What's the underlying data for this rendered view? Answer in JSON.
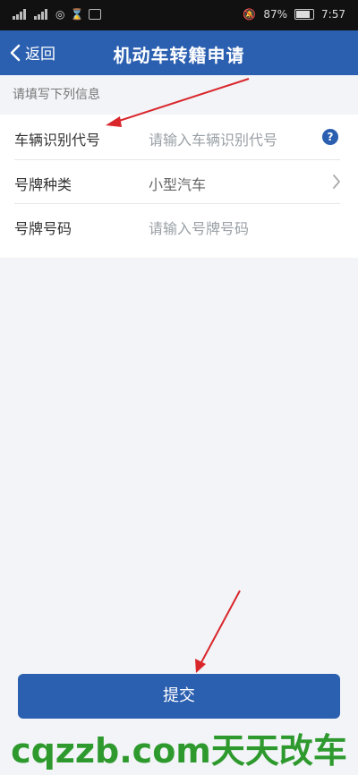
{
  "status_bar": {
    "battery": "87%",
    "time": "7:57"
  },
  "nav": {
    "back_label": "返回",
    "title": "机动车转籍申请"
  },
  "form": {
    "hint": "请填写下列信息",
    "fields": [
      {
        "label": "车辆识别代号",
        "placeholder": "请输入车辆识别代号",
        "value": "",
        "icon": "help-icon"
      },
      {
        "label": "号牌种类",
        "value": "小型汽车",
        "icon": "chevron-right-icon"
      },
      {
        "label": "号牌号码",
        "placeholder": "请输入号牌号码",
        "value": ""
      }
    ]
  },
  "submit_label": "提交",
  "watermark": "cqzzb.com天天改车",
  "colors": {
    "primary": "#2b5fb0",
    "background": "#f2f4f8",
    "annotation": "#d9262b",
    "watermark": "#2e9a2e"
  }
}
